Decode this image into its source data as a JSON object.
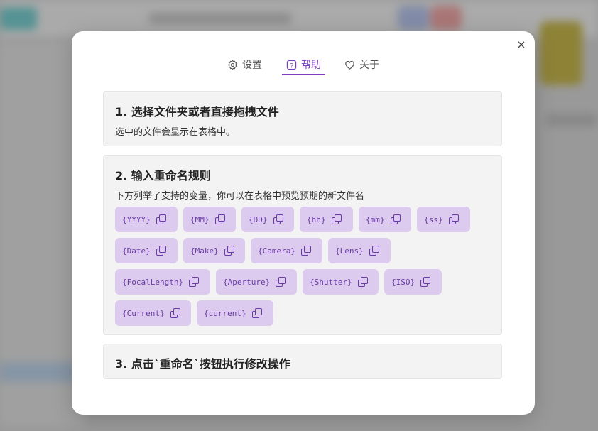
{
  "tabs": [
    {
      "label": "设置",
      "icon": "gear-icon"
    },
    {
      "label": "帮助",
      "icon": "help-icon"
    },
    {
      "label": "关于",
      "icon": "heart-icon"
    }
  ],
  "active_tab": "帮助",
  "close_label": "×",
  "sections": [
    {
      "title": "1. 选择文件夹或者直接拖拽文件",
      "desc": "选中的文件会显示在表格中。"
    },
    {
      "title": "2. 输入重命名规则",
      "desc": "下方列举了支持的变量，你可以在表格中预览预期的新文件名"
    },
    {
      "title": "3. 点击`重命名`按钮执行修改操作"
    }
  ],
  "variables": [
    "{YYYY}",
    "{MM}",
    "{DD}",
    "{hh}",
    "{mm}",
    "{ss}",
    "{Date}",
    "{Make}",
    "{Camera}",
    "{Lens}",
    "{FocalLength}",
    "{Aperture}",
    "{Shutter}",
    "{ISO}",
    "{Current}",
    "{current}"
  ],
  "colors": {
    "accent": "#7b3fbf",
    "chip_bg": "#dccbee",
    "chip_text": "#6a3aa6"
  }
}
